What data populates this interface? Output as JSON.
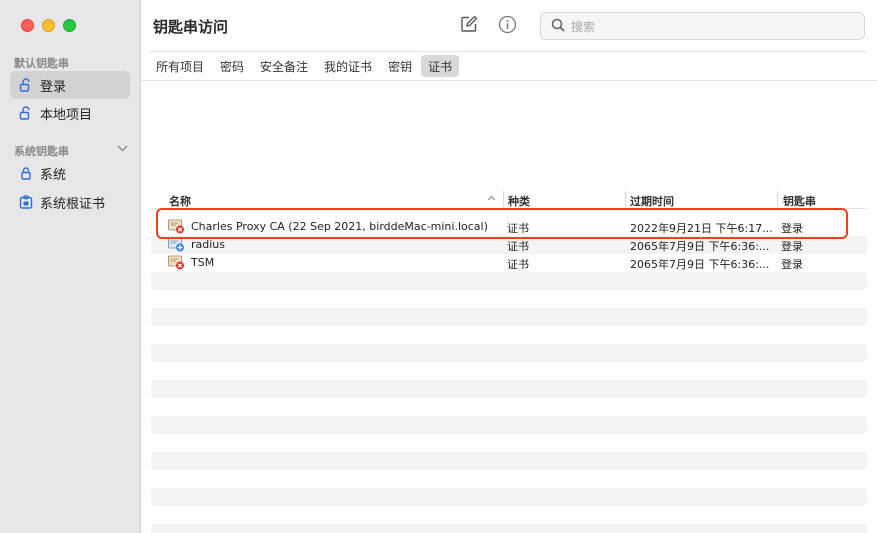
{
  "window": {
    "title": "钥匙串访问"
  },
  "sidebar": {
    "section_default": "默认钥匙串",
    "section_system": "系统钥匙串",
    "items": [
      {
        "label": "登录",
        "icon": "unlocked-padlock-icon",
        "selected": true
      },
      {
        "label": "本地项目",
        "icon": "unlocked-padlock-icon",
        "selected": false
      },
      {
        "label": "系统",
        "icon": "locked-padlock-icon",
        "selected": false
      },
      {
        "label": "系统根证书",
        "icon": "locked-cabinet-icon",
        "selected": false
      }
    ]
  },
  "toolbar": {
    "compose_icon": "compose-icon",
    "info_icon": "info-icon",
    "search_placeholder": "搜索"
  },
  "tabs": [
    {
      "label": "所有项目",
      "active": false
    },
    {
      "label": "密码",
      "active": false
    },
    {
      "label": "安全备注",
      "active": false
    },
    {
      "label": "我的证书",
      "active": false
    },
    {
      "label": "密钥",
      "active": false
    },
    {
      "label": "证书",
      "active": true
    }
  ],
  "table": {
    "columns": {
      "name": "名称",
      "kind": "种类",
      "expire": "过期时间",
      "chain": "钥匙串"
    },
    "rows": [
      {
        "name": "Charles Proxy CA (22 Sep 2021, birddeMac-mini.local)",
        "kind": "证书",
        "expire": "2022年9月21日 下午6:17...",
        "chain": "登录",
        "status": "invalid"
      },
      {
        "name": "radius",
        "kind": "证书",
        "expire": "2065年7月9日 下午6:36:...",
        "chain": "登录",
        "status": "trusted"
      },
      {
        "name": "TSM",
        "kind": "证书",
        "expire": "2065年7月9日 下午6:36:...",
        "chain": "登录",
        "status": "invalid"
      }
    ]
  },
  "colors": {
    "highlight": "#e8431c",
    "sidebar_bg": "#e8e6e8"
  }
}
